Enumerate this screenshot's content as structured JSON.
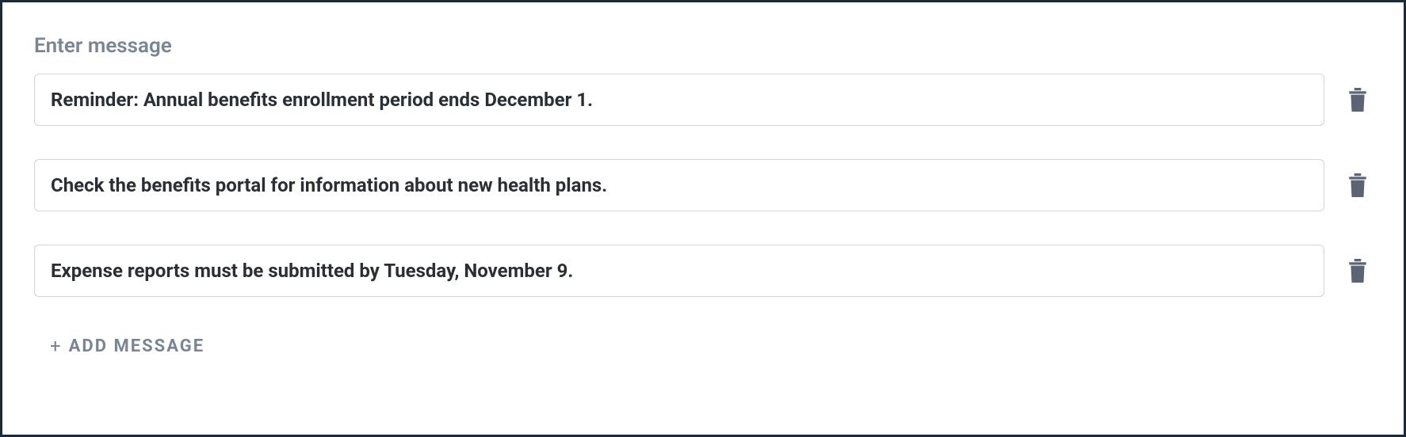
{
  "label": "Enter message",
  "messages": [
    {
      "text": "Reminder: Annual benefits enrollment period ends December 1."
    },
    {
      "text": "Check the benefits portal for information about new health plans."
    },
    {
      "text": "Expense reports must be submitted by Tuesday, November 9."
    }
  ],
  "addButton": {
    "plus": "+",
    "label": "ADD MESSAGE"
  },
  "icons": {
    "trash": "trash-icon"
  }
}
